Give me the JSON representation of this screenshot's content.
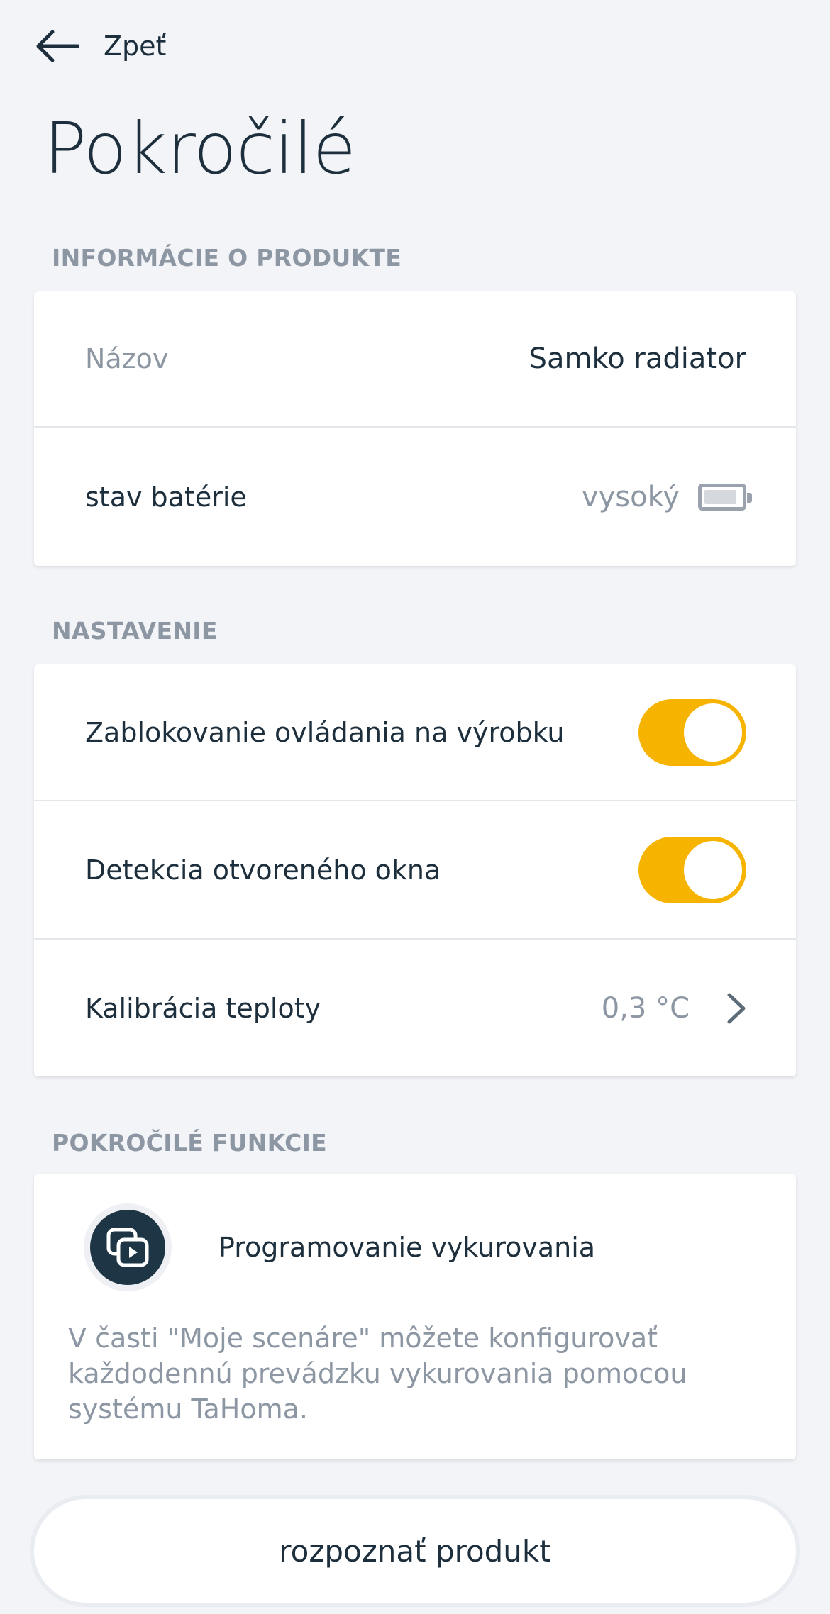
{
  "header": {
    "back_label": "Zpeť",
    "title": "Pokročilé"
  },
  "product_info": {
    "section_title": "INFORMÁCIE O PRODUKTE",
    "name_label": "Názov",
    "name_value": "Samko radiator",
    "battery_label": "stav batérie",
    "battery_value": "vysoký",
    "battery_level": 0.9
  },
  "settings": {
    "section_title": "NASTAVENIE",
    "lock_label": "Zablokovanie ovládania na výrobku",
    "lock_enabled": true,
    "window_label": "Detekcia otvoreného okna",
    "window_enabled": true,
    "calibration_label": "Kalibrácia teploty",
    "calibration_value": "0,3 °C"
  },
  "advanced": {
    "section_title": "POKROČILÉ FUNKCIE",
    "feature_title": "Programovanie vykurovania",
    "feature_description": "V časti \"Moje scenáre\" môžete konfigurovať každodennú prevádzku vykurovania pomocou systému TaHoma.",
    "feature_icon": "scenario-icon"
  },
  "actions": {
    "identify_label": "rozpoznať produkt"
  },
  "colors": {
    "background": "#f2f4f7",
    "accent": "#f6b400",
    "text_primary": "#1d2f3d",
    "text_muted": "#8d97a3"
  }
}
